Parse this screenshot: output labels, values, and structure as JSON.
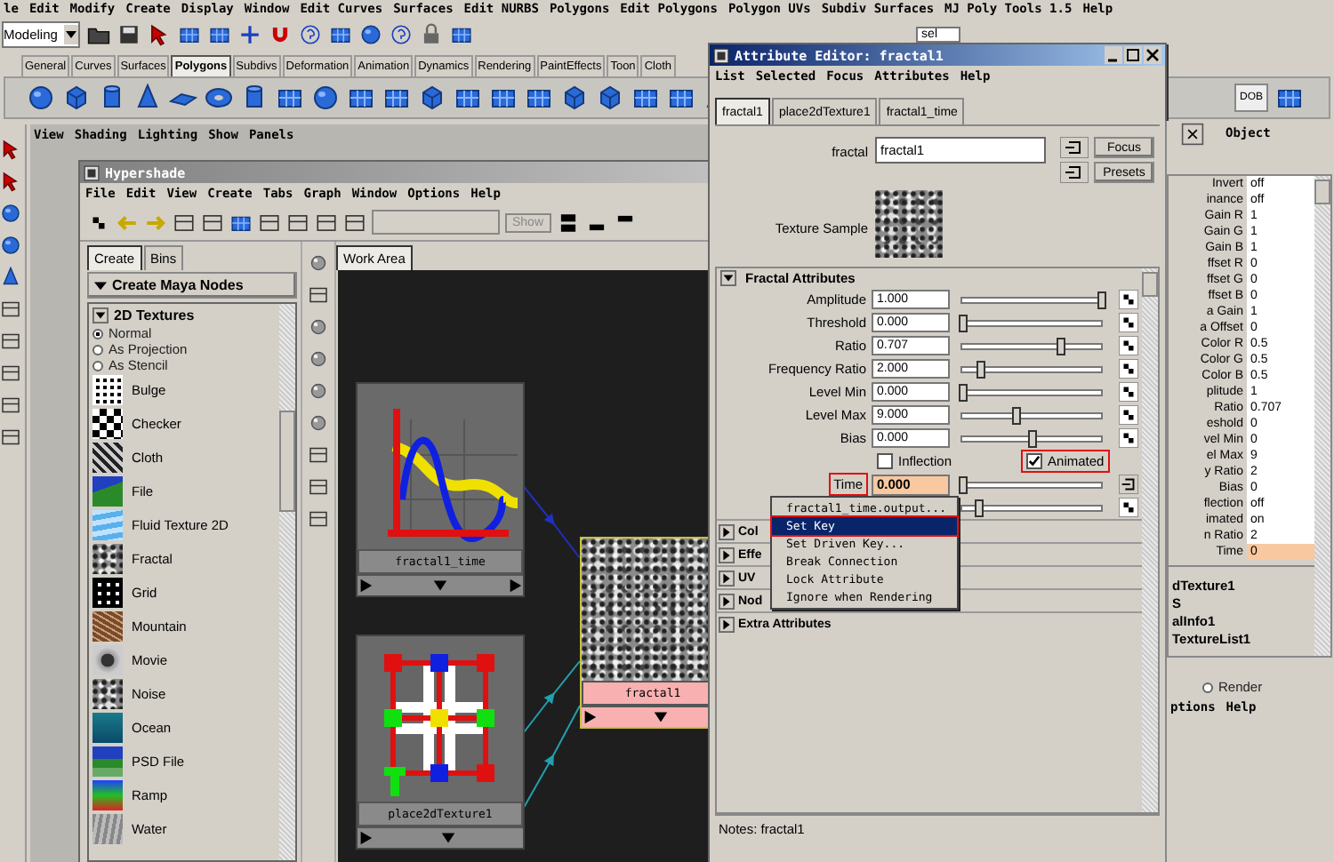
{
  "main_menu": [
    "le",
    "Edit",
    "Modify",
    "Create",
    "Display",
    "Window",
    "Edit Curves",
    "Surfaces",
    "Edit NURBS",
    "Polygons",
    "Edit Polygons",
    "Polygon UVs",
    "Subdiv Surfaces",
    "MJ Poly Tools 1.5",
    "Help"
  ],
  "mode_select": {
    "value": "Modeling"
  },
  "selection_field": "sel",
  "shelf_tabs": [
    {
      "label": "General",
      "selected": false
    },
    {
      "label": "Curves",
      "selected": false
    },
    {
      "label": "Surfaces",
      "selected": false
    },
    {
      "label": "Polygons",
      "selected": true
    },
    {
      "label": "Subdivs",
      "selected": false
    },
    {
      "label": "Deformation",
      "selected": false
    },
    {
      "label": "Animation",
      "selected": false
    },
    {
      "label": "Dynamics",
      "selected": false
    },
    {
      "label": "Rendering",
      "selected": false
    },
    {
      "label": "PaintEffects",
      "selected": false
    },
    {
      "label": "Toon",
      "selected": false
    },
    {
      "label": "Cloth",
      "selected": false
    }
  ],
  "custom_shelf_button": {
    "label": "DOB"
  },
  "panel_menu": [
    "View",
    "Shading",
    "Lighting",
    "Show",
    "Panels"
  ],
  "hypershade": {
    "title": "Hypershade",
    "menu": [
      "File",
      "Edit",
      "View",
      "Create",
      "Tabs",
      "Graph",
      "Window",
      "Options",
      "Help"
    ],
    "show_button": "Show",
    "tabs": [
      {
        "label": "Create",
        "selected": true
      },
      {
        "label": "Bins",
        "selected": false
      }
    ],
    "create_header": "Create Maya Nodes",
    "category": "2D Textures",
    "projection_options": [
      {
        "label": "Normal",
        "selected": true
      },
      {
        "label": "As Projection",
        "selected": false
      },
      {
        "label": "As Stencil",
        "selected": false
      }
    ],
    "textures": [
      {
        "label": "Bulge",
        "kind": "bulge"
      },
      {
        "label": "Checker",
        "kind": "checker"
      },
      {
        "label": "Cloth",
        "kind": "cloth"
      },
      {
        "label": "File",
        "kind": "file"
      },
      {
        "label": "Fluid Texture 2D",
        "kind": "fluid"
      },
      {
        "label": "Fractal",
        "kind": "fractal"
      },
      {
        "label": "Grid",
        "kind": "grid"
      },
      {
        "label": "Mountain",
        "kind": "mountain"
      },
      {
        "label": "Movie",
        "kind": "movie"
      },
      {
        "label": "Noise",
        "kind": "noise"
      },
      {
        "label": "Ocean",
        "kind": "ocean"
      },
      {
        "label": "PSD File",
        "kind": "psd"
      },
      {
        "label": "Ramp",
        "kind": "ramp"
      },
      {
        "label": "Water",
        "kind": "water"
      }
    ],
    "work_area_tab": "Work Area",
    "nodes": [
      {
        "label": "fractal1_time",
        "kind": "curve"
      },
      {
        "label": "place2dTexture1",
        "kind": "placement"
      },
      {
        "label": "fractal1",
        "kind": "texture",
        "selected": true
      }
    ]
  },
  "attribute_editor": {
    "title": "Attribute Editor: fractal1",
    "menu": [
      "List",
      "Selected",
      "Focus",
      "Attributes",
      "Help"
    ],
    "tabs": [
      {
        "label": "fractal1",
        "selected": true
      },
      {
        "label": "place2dTexture1",
        "selected": false
      },
      {
        "label": "fractal1_time",
        "selected": false
      }
    ],
    "name_label": "fractal",
    "name_value": "fractal1",
    "buttons": [
      "Focus",
      "Presets"
    ],
    "sample_label": "Texture Sample",
    "section": "Fractal Attributes",
    "attributes": [
      {
        "label": "Amplitude",
        "value": "1.000",
        "level": 1.0
      },
      {
        "label": "Threshold",
        "value": "0.000",
        "level": 0.0
      },
      {
        "label": "Ratio",
        "value": "0.707",
        "level": 0.7
      },
      {
        "label": "Frequency Ratio",
        "value": "2.000",
        "level": 0.13
      },
      {
        "label": "Level Min",
        "value": "0.000",
        "level": 0.0
      },
      {
        "label": "Level Max",
        "value": "9.000",
        "level": 0.38
      },
      {
        "label": "Bias",
        "value": "0.000",
        "level": 0.5
      }
    ],
    "checkboxes": [
      {
        "label": "Inflection",
        "checked": false,
        "highlighted": false
      },
      {
        "label": "Animated",
        "checked": true,
        "highlighted": true
      }
    ],
    "time": {
      "label": "Time",
      "value": "0.000",
      "level": 0.0,
      "connected": true,
      "highlighted": true
    },
    "fractal_time_slider": {
      "level": 0.12
    },
    "context_menu": [
      {
        "label": "fractal1_time.output...",
        "selected": false,
        "highlighted": false
      },
      {
        "label": "Set Key",
        "selected": true,
        "highlighted": true
      },
      {
        "label": "Set Driven Key...",
        "selected": false,
        "highlighted": false
      },
      {
        "label": "Break Connection",
        "selected": false,
        "highlighted": false
      },
      {
        "label": "Lock Attribute",
        "selected": false,
        "highlighted": false
      },
      {
        "label": "Ignore when Rendering",
        "selected": false,
        "highlighted": false
      }
    ],
    "collapsed_sections": [
      "Col",
      "Effe",
      "UV",
      "Nod",
      "Extra Attributes"
    ],
    "notes": "Notes: fractal1"
  },
  "channel_box": {
    "header": "Object",
    "rows": [
      {
        "label": "Invert",
        "value": "off",
        "selected": false
      },
      {
        "label": "inance",
        "value": "off",
        "selected": false
      },
      {
        "label": "Gain R",
        "value": "1",
        "selected": false
      },
      {
        "label": "Gain G",
        "value": "1",
        "selected": false
      },
      {
        "label": "Gain B",
        "value": "1",
        "selected": false
      },
      {
        "label": "ffset R",
        "value": "0",
        "selected": false
      },
      {
        "label": "ffset G",
        "value": "0",
        "selected": false
      },
      {
        "label": "ffset B",
        "value": "0",
        "selected": false
      },
      {
        "label": "a Gain",
        "value": "1",
        "selected": false
      },
      {
        "label": "a Offset",
        "value": "0",
        "selected": false
      },
      {
        "label": "Color R",
        "value": "0.5",
        "selected": false
      },
      {
        "label": "Color G",
        "value": "0.5",
        "selected": false
      },
      {
        "label": "Color B",
        "value": "0.5",
        "selected": false
      },
      {
        "label": "plitude",
        "value": "1",
        "selected": false
      },
      {
        "label": "Ratio",
        "value": "0.707",
        "selected": false
      },
      {
        "label": "eshold",
        "value": "0",
        "selected": false
      },
      {
        "label": "vel Min",
        "value": "0",
        "selected": false
      },
      {
        "label": "el Max",
        "value": "9",
        "selected": false
      },
      {
        "label": "y Ratio",
        "value": "2",
        "selected": false
      },
      {
        "label": "Bias",
        "value": "0",
        "selected": false
      },
      {
        "label": "flection",
        "value": "off",
        "selected": false
      },
      {
        "label": "imated",
        "value": "on",
        "selected": false
      },
      {
        "label": "n Ratio",
        "value": "2",
        "selected": false
      },
      {
        "label": "Time",
        "value": "0",
        "selected": true
      }
    ],
    "connections": [
      "dTexture1",
      "S",
      "alInfo1",
      "TextureList1"
    ],
    "render_option": {
      "label": "Render",
      "selected": false
    },
    "menu": [
      "ptions",
      "Help"
    ]
  }
}
